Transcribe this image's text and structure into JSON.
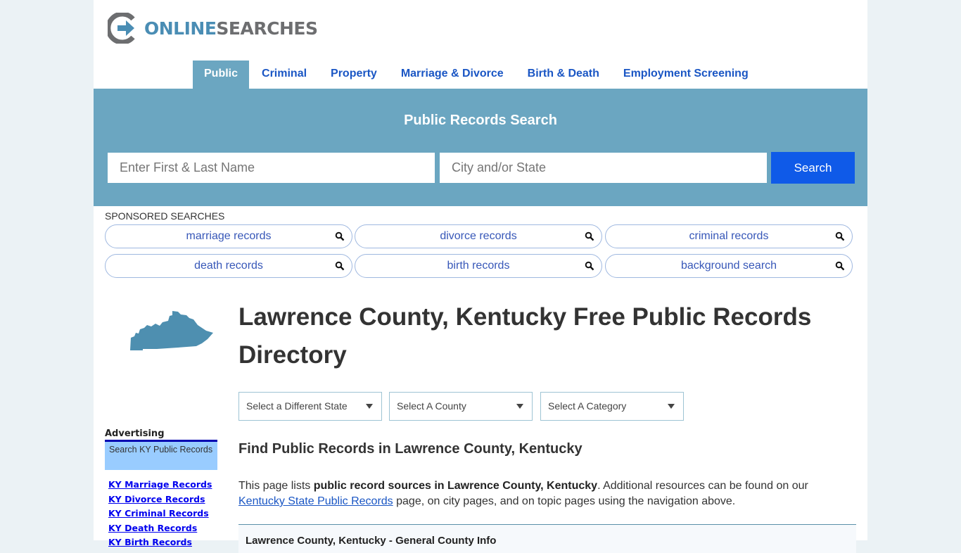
{
  "logo": {
    "part1": "ONLINE",
    "part2": "SEARCHES"
  },
  "colors": {
    "accent": "#6ba6c1",
    "button": "#0f5ae8",
    "link": "#1a56c4",
    "logo_blue": "#4a8db4",
    "logo_gray": "#6d6e70"
  },
  "nav": {
    "items": [
      {
        "label": "Public",
        "active": true
      },
      {
        "label": "Criminal"
      },
      {
        "label": "Property"
      },
      {
        "label": "Marriage & Divorce"
      },
      {
        "label": "Birth & Death"
      },
      {
        "label": "Employment Screening"
      }
    ]
  },
  "search": {
    "title": "Public Records Search",
    "name_placeholder": "Enter First & Last Name",
    "location_placeholder": "City and/or State",
    "button_label": "Search"
  },
  "sponsored": {
    "label": "SPONSORED SEARCHES",
    "items": [
      {
        "label": "marriage records",
        "icon": "search-icon"
      },
      {
        "label": "divorce records",
        "icon": "search-icon"
      },
      {
        "label": "criminal records",
        "icon": "search-icon"
      },
      {
        "label": "death records",
        "icon": "search-icon"
      },
      {
        "label": "birth records",
        "icon": "search-icon"
      },
      {
        "label": "background search",
        "icon": "search-icon"
      }
    ]
  },
  "sidebar": {
    "advertising_label": "Advertising",
    "ad_box_text": "Search KY Public Records",
    "links": [
      "KY Marriage Records",
      "KY Divorce Records",
      "KY Criminal Records",
      "KY Death Records",
      "KY Birth Records"
    ]
  },
  "main": {
    "title": "Lawrence County, Kentucky Free Public Records Directory",
    "selects": [
      {
        "value": "Select a Different State"
      },
      {
        "value": "Select A County"
      },
      {
        "value": "Select A Category"
      }
    ],
    "subtitle": "Find Public Records in Lawrence County, Kentucky",
    "intro": {
      "prefix": "This page lists ",
      "bold": "public record sources in Lawrence County, Kentucky",
      "middle": ". Additional resources can be found on our ",
      "link": "Kentucky State Public Records",
      "suffix": " page, on city pages, and on topic pages using the navigation above."
    },
    "info_box_title": "Lawrence County, Kentucky - General County Info"
  }
}
